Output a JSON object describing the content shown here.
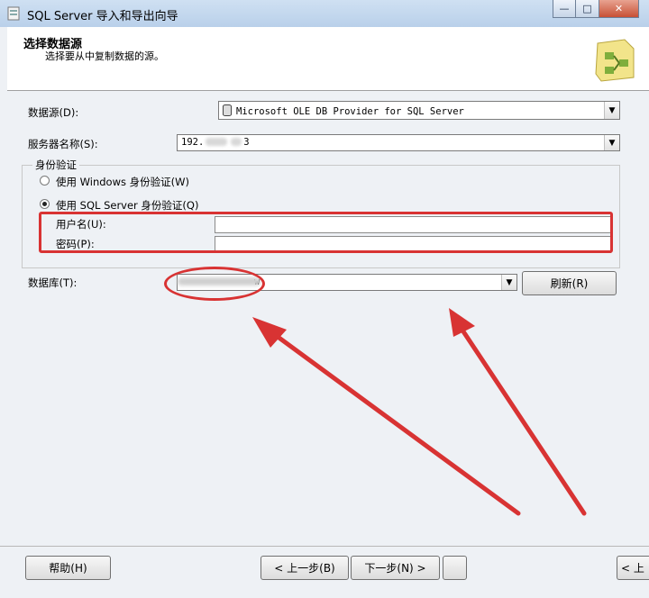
{
  "window": {
    "title": "SQL Server 导入和导出向导",
    "controls": {
      "minimize": "—",
      "maximize": "□",
      "close": "✕"
    }
  },
  "header": {
    "title": "选择数据源",
    "subtitle": "选择要从中复制数据的源。",
    "graphic_icon": "wizard-graphic-icon"
  },
  "form": {
    "datasource_label": "数据源(D):",
    "datasource_value": "Microsoft OLE DB Provider for SQL Server",
    "server_label": "服务器名称(S):",
    "server_value_prefix": "192.",
    "server_value_suffix": "3",
    "auth_group_title": "身份验证",
    "windows_auth_label": "使用 Windows 身份验证(W)",
    "sql_auth_label": "使用 SQL Server 身份验证(Q)",
    "selected_auth": "sql",
    "username_label": "用户名(U):",
    "username_value": "",
    "password_label": "密码(P):",
    "password_value": "",
    "database_label": "数据库(T):",
    "database_value_tail": "w",
    "refresh_label": "刷新(R)"
  },
  "footer": {
    "help_label": "帮助(H)",
    "back_label": "< 上一步(B)",
    "next_label": "下一步(N) >",
    "finish_partial": "<  上"
  },
  "colors": {
    "annotation_red": "#d83333",
    "titlebar": "#b9d0ea",
    "background": "#eef1f5"
  }
}
